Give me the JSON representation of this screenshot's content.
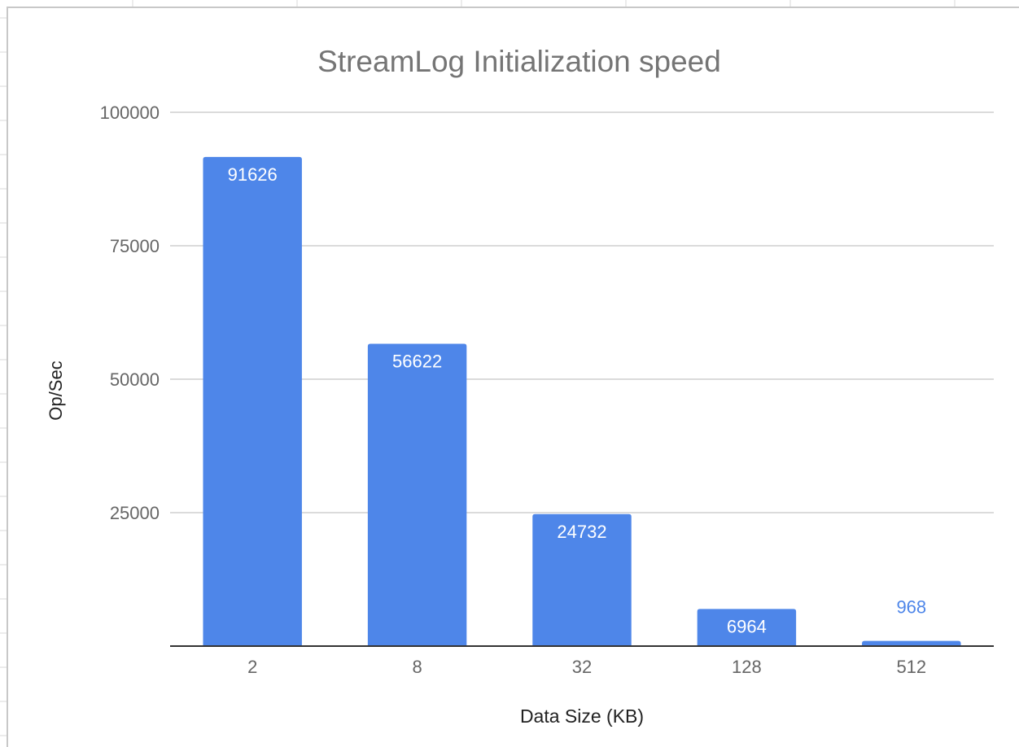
{
  "chart_data": {
    "type": "bar",
    "title": "StreamLog Initialization speed",
    "xlabel": "Data Size (KB)",
    "ylabel": "Op/Sec",
    "categories": [
      "2",
      "8",
      "32",
      "128",
      "512"
    ],
    "values": [
      91626,
      56622,
      24732,
      6964,
      968
    ],
    "data_labels": [
      "91626",
      "56622",
      "24732",
      "6964",
      "968"
    ],
    "ylim": [
      0,
      100000
    ],
    "yticks": [
      25000,
      50000,
      75000,
      100000
    ],
    "ytick_labels": [
      "25000",
      "50000",
      "75000",
      "100000"
    ],
    "grid": true,
    "legend": "none",
    "colors": {
      "bar": "#4e86e9",
      "label_inside": "#ffffff",
      "label_outside": "#4e86e9",
      "grid": "#cfcfcf",
      "axis": "#333333",
      "text": "#666666",
      "title": "#757575"
    }
  }
}
